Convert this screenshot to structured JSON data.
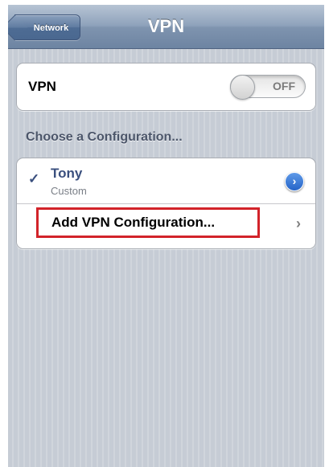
{
  "navbar": {
    "back_label": "Network",
    "title": "VPN"
  },
  "vpn_toggle": {
    "label": "VPN",
    "state_text": "OFF"
  },
  "configurations": {
    "header": "Choose a Configuration...",
    "items": [
      {
        "name": "Tony",
        "type": "Custom",
        "selected": true
      }
    ],
    "add_label": "Add VPN Configuration...",
    "highlight_color": "#d2232a"
  }
}
